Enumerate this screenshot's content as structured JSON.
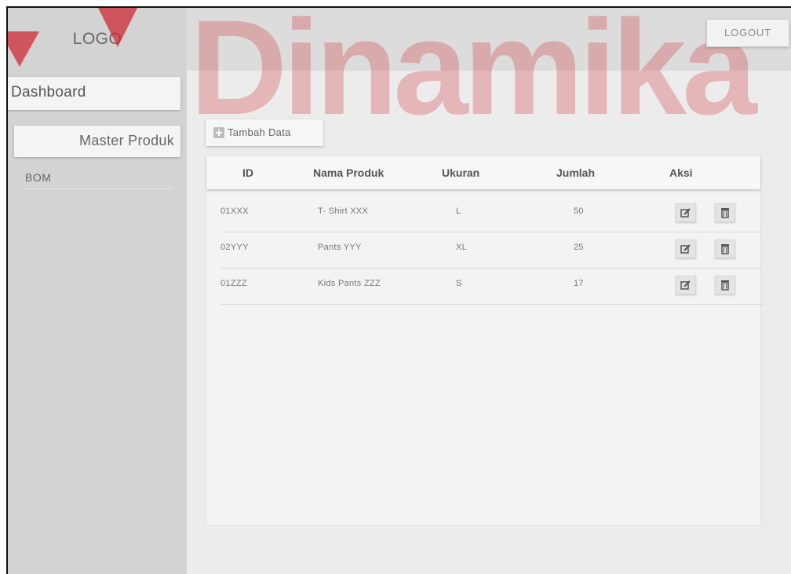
{
  "header": {
    "logo_text": "LOGO",
    "logout_label": "LOGOUT",
    "watermark_text": "Dinamika"
  },
  "sidebar": {
    "items": [
      {
        "label": "Dashboard"
      },
      {
        "label": "Master Produk"
      },
      {
        "label": "BOM"
      }
    ]
  },
  "toolbar": {
    "add_label": "Tambah Data",
    "add_icon": "plus-square-icon"
  },
  "table": {
    "columns": [
      "ID",
      "Nama Produk",
      "Ukuran",
      "Jumlah",
      "Aksi"
    ],
    "rows": [
      {
        "id": "01XXX",
        "name": "T- Shirt XXX",
        "size": "L",
        "qty": "50"
      },
      {
        "id": "02YYY",
        "name": "Pants YYY",
        "size": "XL",
        "qty": "25"
      },
      {
        "id": "01ZZZ",
        "name": "Kids Pants ZZZ",
        "size": "S",
        "qty": "17"
      }
    ],
    "action_icons": [
      "edit-icon",
      "trash-icon"
    ]
  },
  "colors": {
    "watermark": "#cf2a34",
    "sidebar_bg": "#d3d3d3",
    "content_bg": "#ececec"
  }
}
